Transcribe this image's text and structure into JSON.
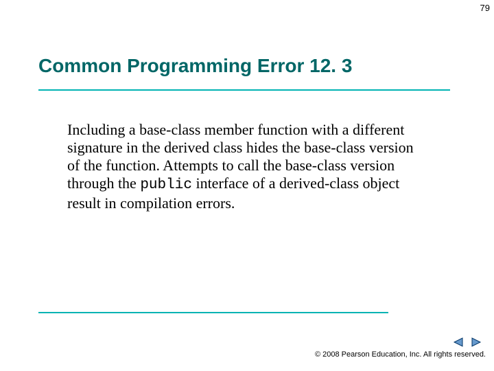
{
  "page_number": "79",
  "title": "Common Programming Error 12. 3",
  "body": {
    "part1": "Including a base-class member function with a different signature in the derived class hides the base-class version of the function. Attempts to call the base-class version through the ",
    "code_word": "public",
    "part2": " interface of a derived-class object result in compilation errors."
  },
  "footer": "© 2008 Pearson Education, Inc.  All rights reserved.",
  "nav": {
    "prev": "prev",
    "next": "next"
  },
  "colors": {
    "accent": "#00b3b3",
    "title_color": "#006666",
    "nav_fill": "#6699cc",
    "nav_stroke": "#003366"
  }
}
